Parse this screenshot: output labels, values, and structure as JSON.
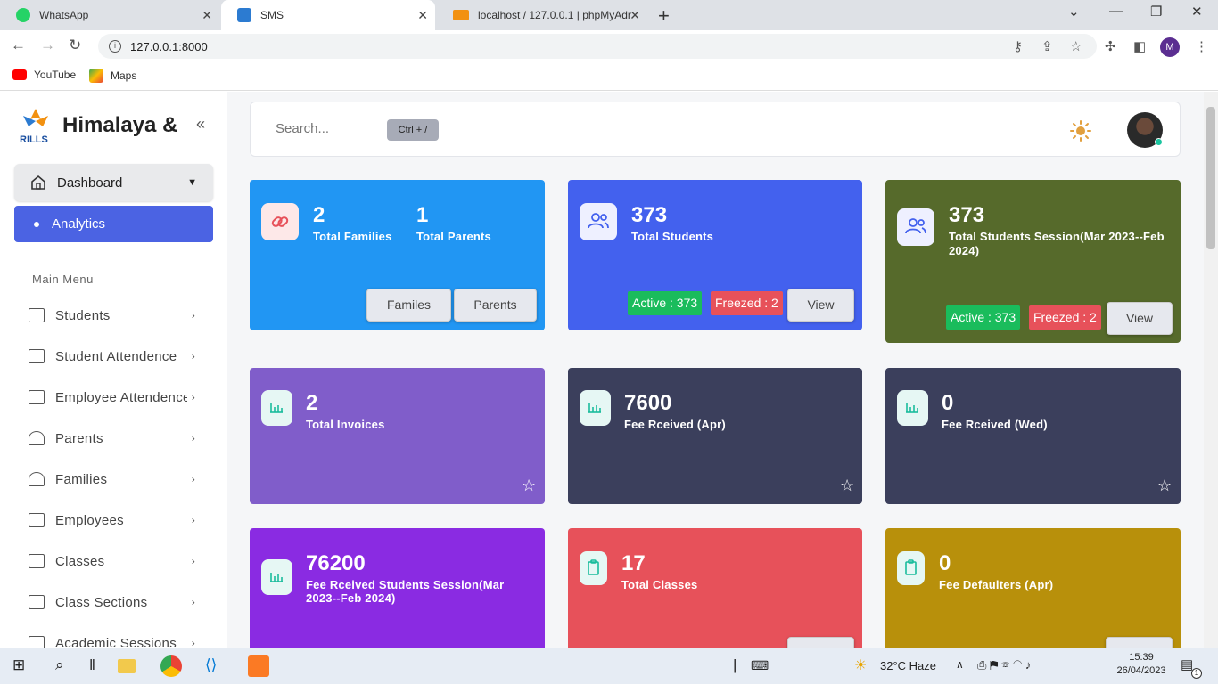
{
  "browser": {
    "tabs": [
      {
        "label": "WhatsApp",
        "color": "#25d366"
      },
      {
        "label": "SMS",
        "color": "#2c7bd1"
      },
      {
        "label": "localhost / 127.0.0.1 | phpMyAdm",
        "color": "#f29111"
      }
    ],
    "url": "127.0.0.1:8000",
    "bookmarks": [
      "YouTube",
      "Maps"
    ],
    "profile_initial": "M"
  },
  "sidebar": {
    "brand": "Himalaya &",
    "logo_text": "RILLS",
    "dashboard": "Dashboard",
    "analytics": "Analytics",
    "menu_heading": "Main Menu",
    "items": [
      "Students",
      "Student Attendence",
      "Employee Attendence",
      "Parents",
      "Families",
      "Employees",
      "Classes",
      "Class Sections",
      "Academic Sessions"
    ]
  },
  "header": {
    "search_placeholder": "Search...",
    "shortcut": "Ctrl + /"
  },
  "cards": {
    "families": {
      "num1": "2",
      "label1": "Total Families",
      "num2": "1",
      "label2": "Total Parents",
      "btn1": "Familes",
      "btn2": "Parents",
      "color": "#2196f3"
    },
    "students": {
      "num": "373",
      "label": "Total Students",
      "active": "Active : 373",
      "freezed": "Freezed : 2",
      "btn": "View",
      "color": "#4361ee"
    },
    "session": {
      "num": "373",
      "label": "Total Students Session(Mar 2023--Feb 2024)",
      "active": "Active : 373",
      "freezed": "Freezed : 2",
      "btn": "View",
      "color": "#566a2b"
    },
    "invoices": {
      "num": "2",
      "label": "Total Invoices",
      "color": "#805dca"
    },
    "fee_apr": {
      "num": "7600",
      "label": "Fee Rceived (Apr)",
      "color": "#3b3f5c"
    },
    "fee_wed": {
      "num": "0",
      "label": "Fee Rceived (Wed)",
      "color": "#3b3f5c"
    },
    "fee_session": {
      "num": "76200",
      "label": "Fee Rceived Students Session(Mar 2023--Feb 2024)",
      "color": "#8a2be2"
    },
    "classes": {
      "num": "17",
      "label": "Total Classes",
      "color": "#e7515a"
    },
    "defaulters": {
      "num": "0",
      "label": "Fee Defaulters (Apr)",
      "color": "#b8900b"
    }
  },
  "taskbar": {
    "weather": "32°C  Haze",
    "time": "15:39",
    "date": "26/04/2023",
    "notifications": "1"
  }
}
